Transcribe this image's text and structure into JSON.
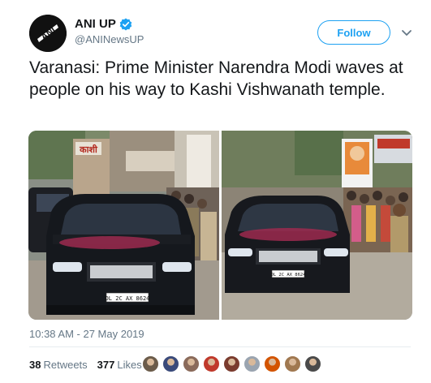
{
  "account": {
    "display_name": "ANI UP",
    "handle": "@ANINewsUP",
    "verified": true,
    "avatar_logo_text": "ANI"
  },
  "actions": {
    "follow_label": "Follow",
    "menu_icon": "chevron-down-icon"
  },
  "tweet": {
    "text": "Varanasi: Prime Minister Narendra Modi waves at people on his way to Kashi Vishwanath temple.",
    "timestamp": "10:38 AM - 27 May 2019"
  },
  "media": {
    "left_photo": {
      "sign_text": "काशी",
      "number_plate": "DL 2C AX 8624"
    },
    "right_photo": {
      "number_plate": "DL 2C AX 8624"
    }
  },
  "stats": {
    "retweets_count": "38",
    "retweets_label": "Retweets",
    "likes_count": "377",
    "likes_label": "Likes"
  },
  "liker_avatar_colors": [
    "#6b5b4a",
    "#3a4a7a",
    "#8a6a5a",
    "#c0392b",
    "#7a3b2e",
    "#9aa4b0",
    "#d35400",
    "#a07850",
    "#4a4a4a"
  ],
  "colors": {
    "accent": "#1da1f2",
    "secondary_text": "#657786",
    "primary_text": "#14171a"
  }
}
